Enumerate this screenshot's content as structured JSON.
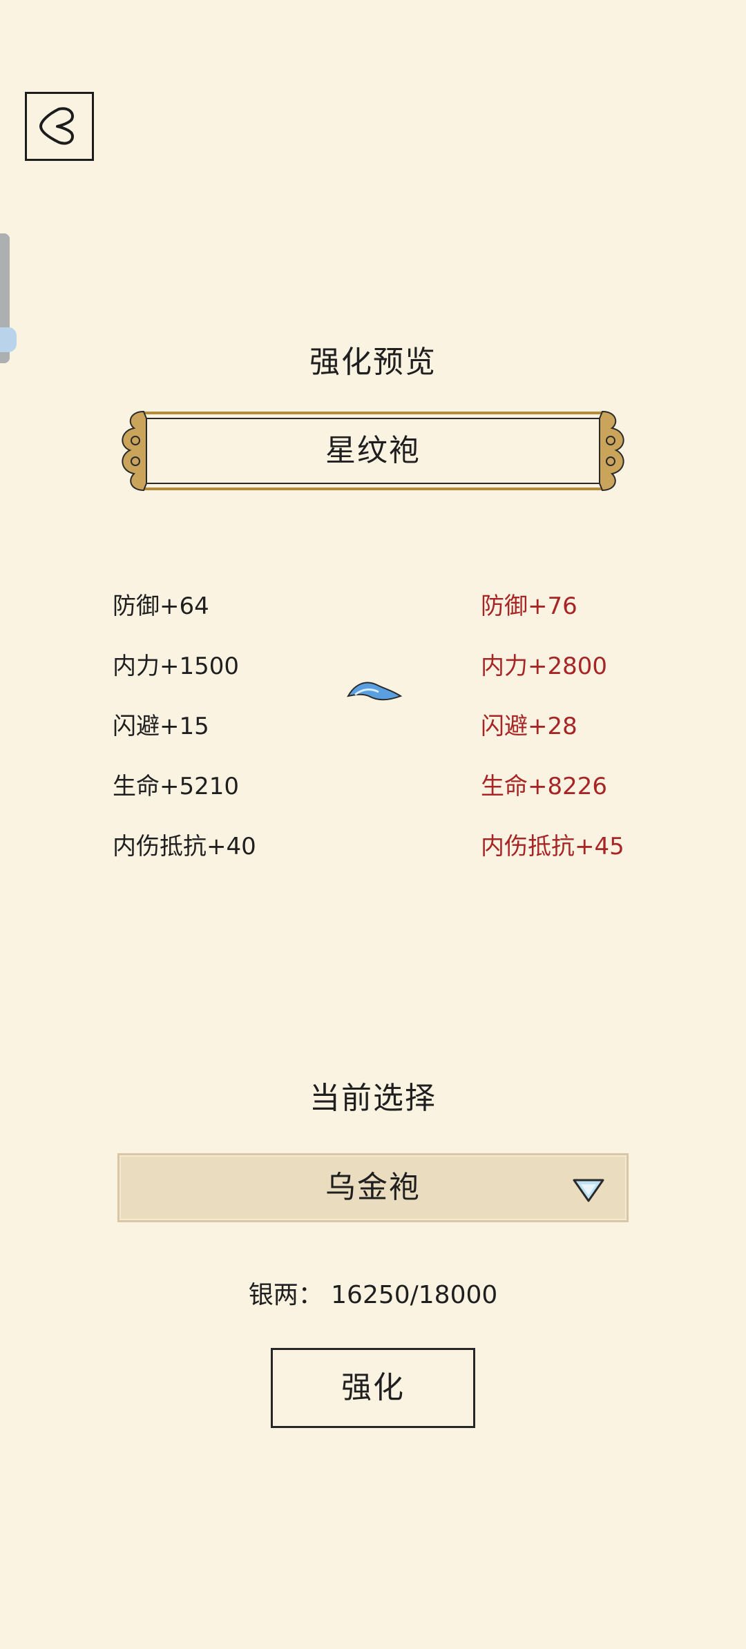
{
  "header": {
    "back_icon": "back-arrow-icon"
  },
  "preview": {
    "title": "强化预览",
    "item_name": "星纹袍",
    "stats_before": [
      "防御+64",
      "内力+1500",
      "闪避+15",
      "生命+5210",
      "内伤抵抗+40"
    ],
    "stats_after": [
      "防御+76",
      "内力+2800",
      "闪避+28",
      "生命+8226",
      "内伤抵抗+45"
    ],
    "arrow_icon": "right-arrow-icon",
    "upgrade_color": "#a82525"
  },
  "selection": {
    "title": "当前选择",
    "selected_item": "乌金袍",
    "dropdown_icon": "chevron-down-icon"
  },
  "currency": {
    "label": "银两：",
    "current": "16250",
    "required": "18000",
    "display": "银两： 16250/18000"
  },
  "actions": {
    "enhance_label": "强化"
  },
  "colors": {
    "background": "#fbf3e2",
    "frame_gold": "#b48d3c",
    "select_bg": "#eadcbf"
  }
}
